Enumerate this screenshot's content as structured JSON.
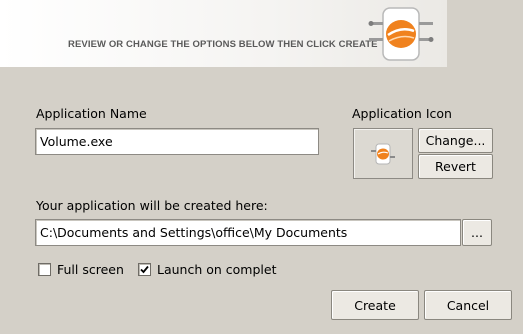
{
  "banner": {
    "instruction": "REVIEW OR CHANGE THE OPTIONS BELOW THEN CLICK CREATE",
    "logo_icon": "app-logo-icon"
  },
  "form": {
    "app_name_label": "Application Name",
    "app_name_value": "Volume.exe",
    "app_icon_label": "Application Icon",
    "change_label": "Change...",
    "revert_label": "Revert",
    "location_label": "Your application will be created here:",
    "location_value": "C:\\Documents and Settings\\office\\My Documents",
    "browse_label": "...",
    "fullscreen_label": "Full screen",
    "fullscreen_checked": false,
    "launch_label": "Launch on completion",
    "launch_checked": true
  },
  "footer": {
    "create_label": "Create",
    "cancel_label": "Cancel"
  },
  "colors": {
    "background": "#d4d0c8",
    "logo_accent": "#f0821e"
  }
}
